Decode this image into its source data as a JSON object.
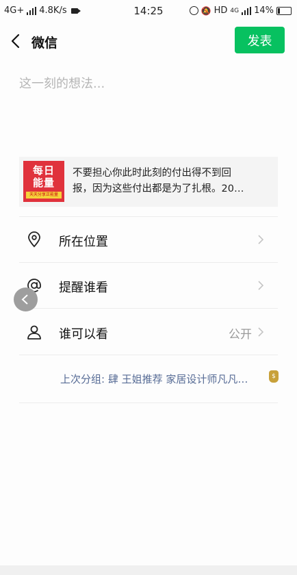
{
  "status_bar": {
    "network": "4G+",
    "speed": "4.8K/s",
    "time": "14:25",
    "hd": "HD",
    "net2": "4G",
    "battery": "14%"
  },
  "nav": {
    "title": "微信",
    "publish_label": "发表"
  },
  "compose": {
    "placeholder": "这一刻的想法..."
  },
  "share_card": {
    "thumb_title_1": "每日",
    "thumb_title_2": "能量",
    "thumb_caption": "天天分享正能量",
    "line1": "不要担心你此时此刻的付出得不到回",
    "line2": "报，因为这些付出都是为了扎根。20…"
  },
  "options": [
    {
      "label": "所在位置",
      "icon": "location-pin-icon"
    },
    {
      "label": "提醒谁看",
      "icon": "at-icon"
    },
    {
      "label": "谁可以看",
      "icon": "person-icon",
      "value": "公开"
    }
  ],
  "last_group": {
    "text": "上次分组: 肆 王姐推荐 家居设计师凡凡…",
    "icon": "money-bag-icon"
  },
  "colors": {
    "accent": "#07c160",
    "link": "#566b95",
    "thumb": "#e0323c"
  }
}
